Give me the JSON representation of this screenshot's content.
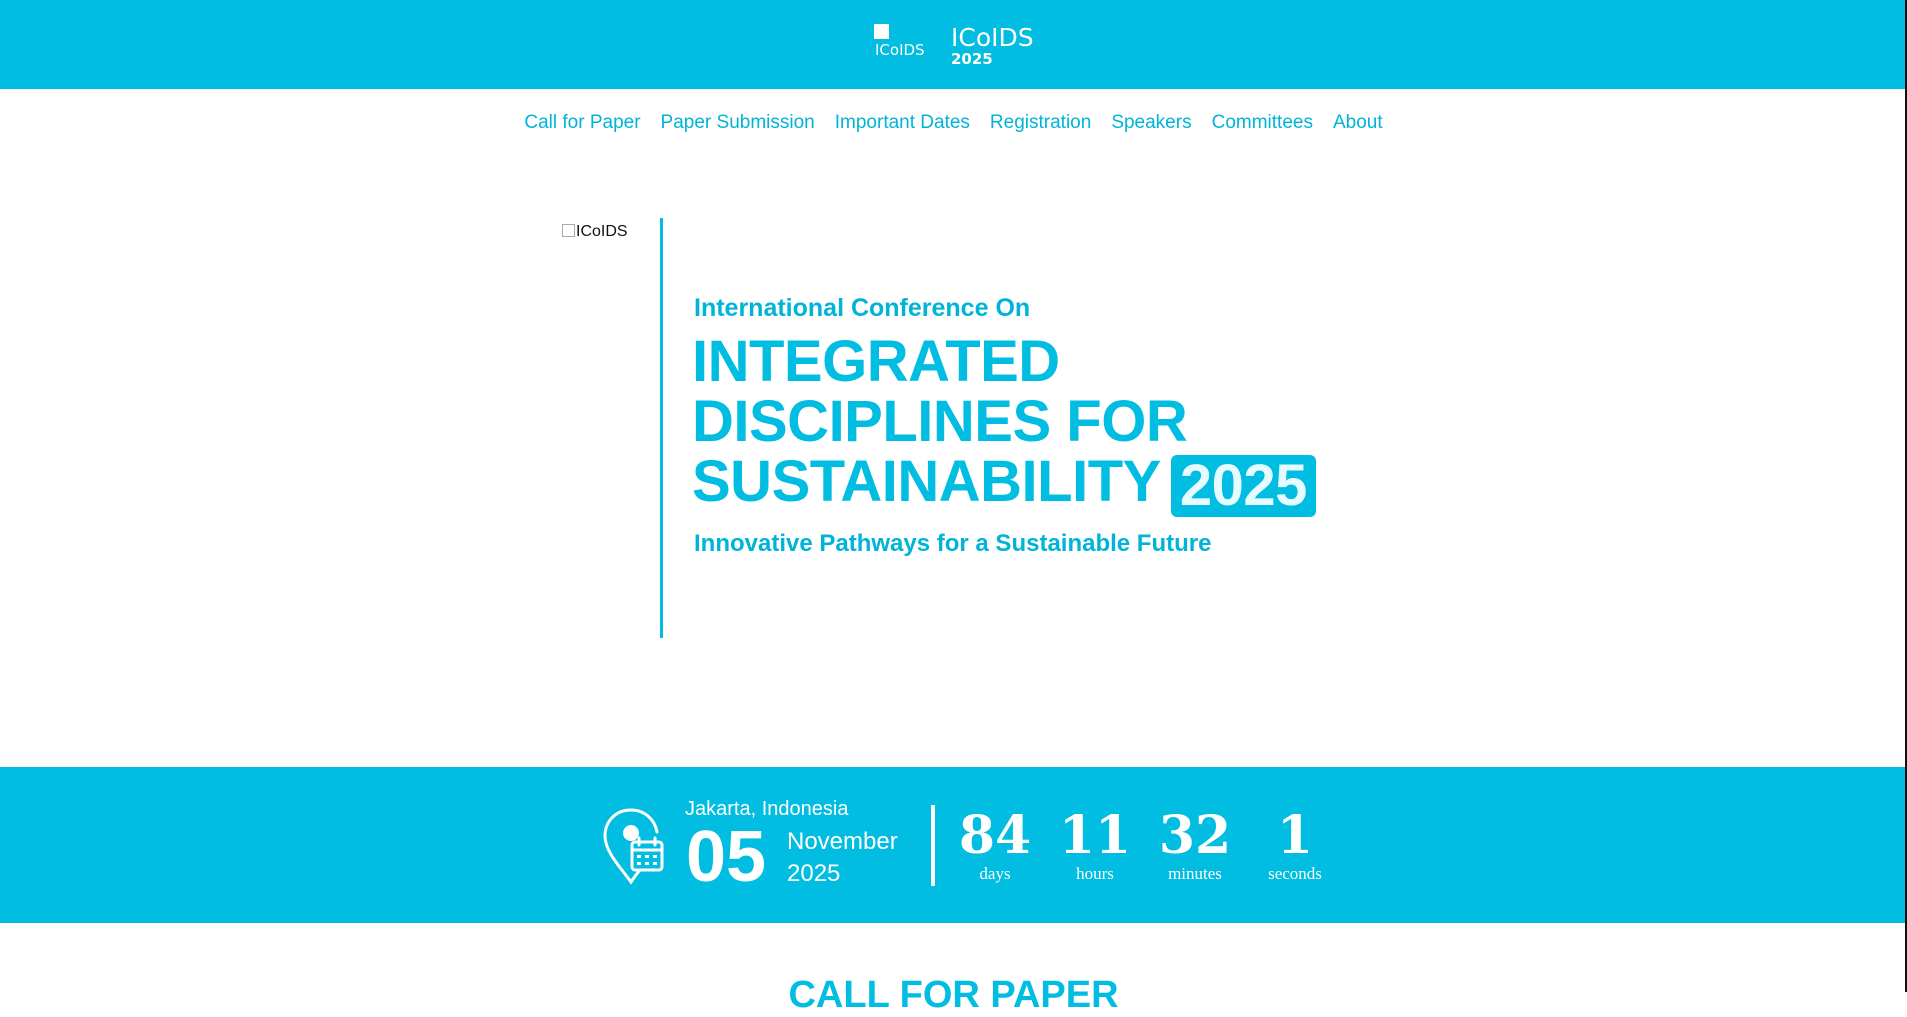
{
  "header": {
    "logo_alt": "ICoIDS",
    "brand_name": "ICoIDS",
    "brand_year": "2025",
    "bg_color": "#00bde1"
  },
  "nav": {
    "items": [
      {
        "label": "Call for Paper"
      },
      {
        "label": "Paper Submission"
      },
      {
        "label": "Important Dates"
      },
      {
        "label": "Registration"
      },
      {
        "label": "Speakers"
      },
      {
        "label": "Committees"
      },
      {
        "label": "About"
      }
    ]
  },
  "hero": {
    "logo_alt": "ICoIDS",
    "pretitle": "International Conference On",
    "title_lines": [
      "INTEGRATED",
      "DISCIPLINES FOR",
      "SUSTAINABILITY"
    ],
    "year_badge": "2025",
    "subtitle": "Innovative Pathways for a Sustainable Future"
  },
  "event": {
    "location": "Jakarta, Indonesia",
    "day": "05",
    "month": "November",
    "year": "2025",
    "icon": "location-calendar-icon"
  },
  "countdown": [
    {
      "value": "84",
      "unit": "days"
    },
    {
      "value": "11",
      "unit": "hours"
    },
    {
      "value": "32",
      "unit": "minutes"
    },
    {
      "value": "1",
      "unit": "seconds"
    }
  ],
  "next_section": {
    "title": "CALL FOR PAPER"
  }
}
